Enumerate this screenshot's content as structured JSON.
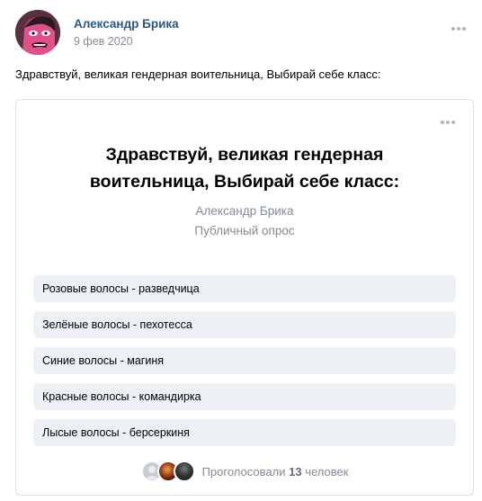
{
  "post": {
    "author": "Александр Брика",
    "date": "9 фев 2020",
    "text": "Здравствуй, великая гендерная воительница, Выбирай себе класс:"
  },
  "poll": {
    "title_line1": "Здравствуй, великая гендерная",
    "title_line2": "воительница, Выбирай себе класс:",
    "author": "Александр Брика",
    "type": "Публичный опрос",
    "options": [
      {
        "label": "Розовые волосы - разведчица"
      },
      {
        "label": "Зелёные волосы - пехотесса"
      },
      {
        "label": "Синие волосы - магиня"
      },
      {
        "label": "Красные волосы - командирка"
      },
      {
        "label": "Лысые волосы - берсеркиня"
      }
    ],
    "footer": {
      "voted_prefix": "Проголосовали",
      "voted_count": "13",
      "voted_suffix": "человек"
    }
  },
  "icons": {
    "post_menu": "more-horizontal-icon",
    "poll_menu": "more-horizontal-icon"
  },
  "colors": {
    "author_link": "#2a5885",
    "muted_text": "#818c99",
    "option_bg": "#edf0f5",
    "card_border": "#dce1e6"
  }
}
